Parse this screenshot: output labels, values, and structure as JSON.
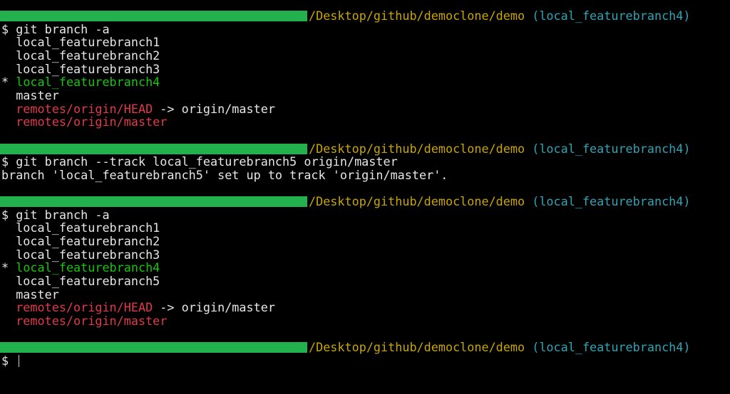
{
  "prompt": {
    "path": "/Desktop/github/democlone/demo",
    "branch": "(local_featurebranch4)",
    "symbol": "$"
  },
  "colors": {
    "bar": "#22b14c",
    "path": "#c8a600",
    "branch": "#2fa4b4",
    "remote": "#e03a48",
    "current": "#16c60c"
  },
  "blocks": [
    {
      "command": "git branch -a",
      "output": [
        {
          "text": "  local_featurebranch1",
          "style": "normal"
        },
        {
          "text": "  local_featurebranch2",
          "style": "normal"
        },
        {
          "text": "  local_featurebranch3",
          "style": "normal"
        },
        {
          "marker": "* ",
          "text": "local_featurebranch4",
          "style": "current"
        },
        {
          "text": "  master",
          "style": "normal"
        },
        {
          "text": "  remotes/origin/HEAD",
          "suffix": " -> origin/master",
          "style": "remote"
        },
        {
          "text": "  remotes/origin/master",
          "style": "remote"
        }
      ]
    },
    {
      "command": "git branch --track local_featurebranch5 origin/master",
      "output": [
        {
          "text": "branch 'local_featurebranch5' set up to track 'origin/master'.",
          "style": "normal"
        }
      ]
    },
    {
      "command": "git branch -a",
      "output": [
        {
          "text": "  local_featurebranch1",
          "style": "normal"
        },
        {
          "text": "  local_featurebranch2",
          "style": "normal"
        },
        {
          "text": "  local_featurebranch3",
          "style": "normal"
        },
        {
          "marker": "* ",
          "text": "local_featurebranch4",
          "style": "current"
        },
        {
          "text": "  local_featurebranch5",
          "style": "normal"
        },
        {
          "text": "  master",
          "style": "normal"
        },
        {
          "text": "  remotes/origin/HEAD",
          "suffix": " -> origin/master",
          "style": "remote"
        },
        {
          "text": "  remotes/origin/master",
          "style": "remote"
        }
      ]
    },
    {
      "command": "",
      "output": []
    }
  ]
}
